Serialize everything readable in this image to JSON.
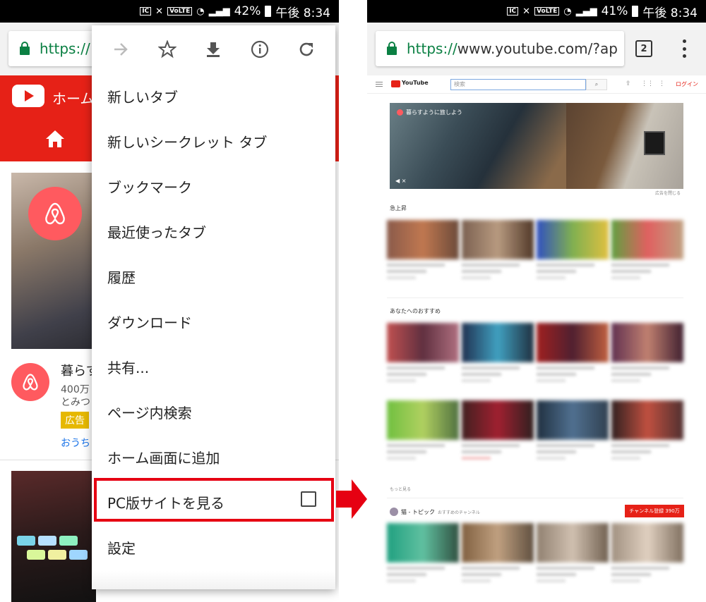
{
  "status_left": {
    "battery": "42%",
    "time": "午後 8:34",
    "carrier_box": "IC",
    "lte": "VoLTE"
  },
  "status_right": {
    "battery": "41%",
    "time": "午後 8:34",
    "carrier_box": "IC",
    "lte": "VoLTE"
  },
  "left_phone": {
    "url": "https://",
    "tab_label": "ホーム",
    "video_title": "暮らす",
    "video_views": "400万",
    "video_sub": "とみつ",
    "ad_badge": "広告",
    "channel_link": "おうち"
  },
  "menu": {
    "icons": [
      "forward-icon",
      "star-icon",
      "download-icon",
      "info-icon",
      "reload-icon"
    ],
    "items": [
      "新しいタブ",
      "新しいシークレット タブ",
      "ブックマーク",
      "最近使ったタブ",
      "履歴",
      "ダウンロード",
      "共有...",
      "ページ内検索",
      "ホーム画面に追加",
      "PC版サイトを見る",
      "設定"
    ],
    "desktop_site_checked": false
  },
  "right_phone": {
    "url_scheme": "https://",
    "url_rest": "www.youtube.com/?ap",
    "tab_count": "2",
    "search_placeholder": "検索",
    "logo_text": "YouTube",
    "login": "ログイン",
    "hero_caption": "暮らすように旅しよう",
    "ad_note": "広告を閉じる",
    "section_trending": "急上昇",
    "section_recommended": "あなたへのおすすめ",
    "more_link": "もっと見る",
    "channel_name": "猫 - トピック",
    "channel_sub": "おすすめのチャンネル",
    "subscribe": "チャンネル登録 390万"
  },
  "colors": {
    "youtube_red": "#e62117",
    "chrome_green": "#0b8043",
    "airbnb": "#ff5a5f",
    "highlight_red": "#e60012"
  }
}
